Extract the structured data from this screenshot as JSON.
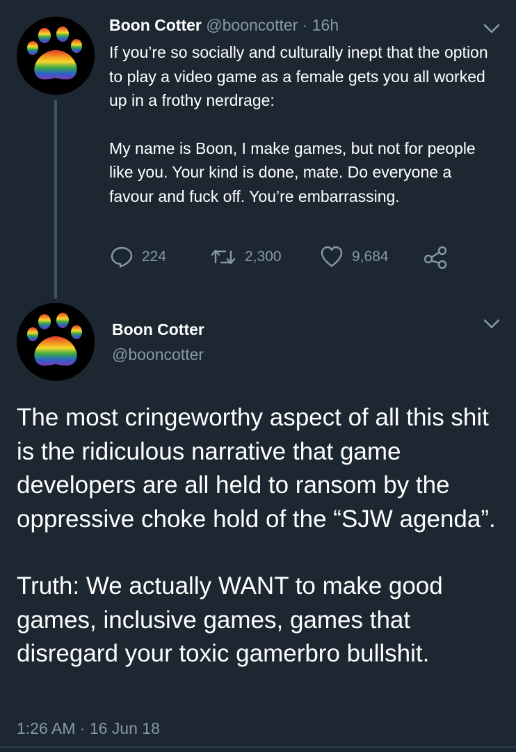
{
  "reply_tweet": {
    "author_name": "Boon Cotter",
    "author_handle": "@booncotter",
    "separator": "·",
    "time": "16h",
    "paragraphs": [
      "If you’re so socially and culturally inept that the option to play a video game as a female gets you all worked up in a frothy nerdrage:",
      "My name is Boon, I make games, but not for people like you. Your kind is done, mate. Do everyone a favour and fuck off. You’re embarrassing."
    ],
    "actions": {
      "replies": "224",
      "retweets": "2,300",
      "likes": "9,684"
    }
  },
  "main_tweet": {
    "author_name": "Boon Cotter",
    "author_handle": "@booncotter",
    "paragraphs": [
      "The most cringeworthy aspect of all this shit is the ridiculous narrative that game developers are all held to ransom by the oppressive choke hold of the “SJW agenda”.",
      "Truth: We actually WANT to make good games, inclusive games, games that disregard your toxic gamerbro bullshit."
    ],
    "timestamp": "1:26 AM · 16 Jun 18"
  },
  "icons": {
    "avatar": "rainbow-paw-icon",
    "menu": "chevron-down-icon",
    "reply": "speech-bubble-icon",
    "retweet": "retweet-icon",
    "like": "heart-icon",
    "share": "share-icon"
  },
  "colors": {
    "background": "#1c2732",
    "text_primary": "#ffffff",
    "text_secondary": "#8899a6",
    "thread_line": "#3d5466"
  }
}
